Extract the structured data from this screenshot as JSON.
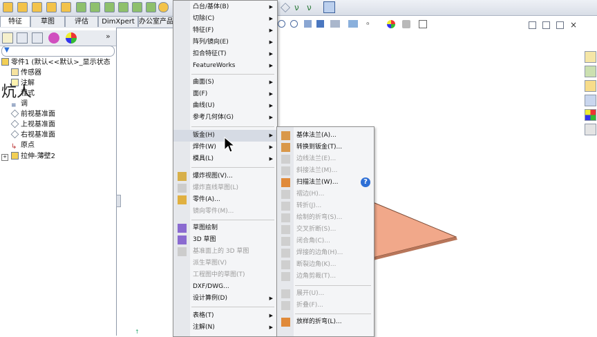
{
  "tabs": [
    {
      "label": "特征"
    },
    {
      "label": "草图"
    },
    {
      "label": "评估"
    },
    {
      "label": "DimXpert"
    },
    {
      "label": "办公室产品"
    }
  ],
  "tree": {
    "items": [
      {
        "label": "零件1  (默认<<默认>_显示状态"
      },
      {
        "label": "传感器"
      },
      {
        "label": "注解"
      },
      {
        "label": "程式"
      },
      {
        "label": "调"
      },
      {
        "label": "前视基准面"
      },
      {
        "label": "上视基准面"
      },
      {
        "label": "右视基准面"
      },
      {
        "label": "原点"
      },
      {
        "label": "拉伸-薄壁2"
      }
    ]
  },
  "watermark": {
    "text": "炕人"
  },
  "insert_menu": {
    "items": [
      {
        "label": "凸台/基体(B)"
      },
      {
        "label": "切除(C)"
      },
      {
        "label": "特征(F)"
      },
      {
        "label": "阵列/镜向(E)"
      },
      {
        "label": "扣合特征(T)"
      },
      {
        "label": "FeatureWorks"
      },
      {
        "label": "曲面(S)"
      },
      {
        "label": "面(F)"
      },
      {
        "label": "曲线(U)"
      },
      {
        "label": "参考几何体(G)"
      },
      {
        "label": "钣金(H)"
      },
      {
        "label": "焊件(W)"
      },
      {
        "label": "模具(L)"
      },
      {
        "label": "爆炸视图(V)..."
      },
      {
        "label": "爆炸直线草图(L)"
      },
      {
        "label": "零件(A)..."
      },
      {
        "label": "镜向零件(M)..."
      },
      {
        "label": "草图绘制"
      },
      {
        "label": "3D 草图"
      },
      {
        "label": "基准面上的 3D 草图"
      },
      {
        "label": "派生草图(V)"
      },
      {
        "label": "工程图中的草图(T)"
      },
      {
        "label": "DXF/DWG..."
      },
      {
        "label": "设计算例(D)"
      },
      {
        "label": "表格(T)"
      },
      {
        "label": "注解(N)"
      }
    ]
  },
  "sheetmetal_menu": {
    "items": [
      {
        "label": "基体法兰(A)..."
      },
      {
        "label": "转换到钣金(T)..."
      },
      {
        "label": "边线法兰(E)..."
      },
      {
        "label": "斜接法兰(M)..."
      },
      {
        "label": "扫描法兰(W)..."
      },
      {
        "label": "褶边(H)..."
      },
      {
        "label": "转折(J)..."
      },
      {
        "label": "绘制的折弯(S)..."
      },
      {
        "label": "交叉折断(S)..."
      },
      {
        "label": "闭合角(C)..."
      },
      {
        "label": "焊接的边角(H)..."
      },
      {
        "label": "断裂边角(K)..."
      },
      {
        "label": "边角剪裁(T)..."
      },
      {
        "label": "展开(U)..."
      },
      {
        "label": "折叠(F)..."
      },
      {
        "label": "放样的折弯(L)..."
      }
    ]
  },
  "colors": {
    "accent": "#2d6fd6",
    "part_face": "#f1a88a",
    "part_edge": "#7a4a35",
    "menu_bg": "#f4f5f7",
    "highlight": "#d6dbe4"
  }
}
